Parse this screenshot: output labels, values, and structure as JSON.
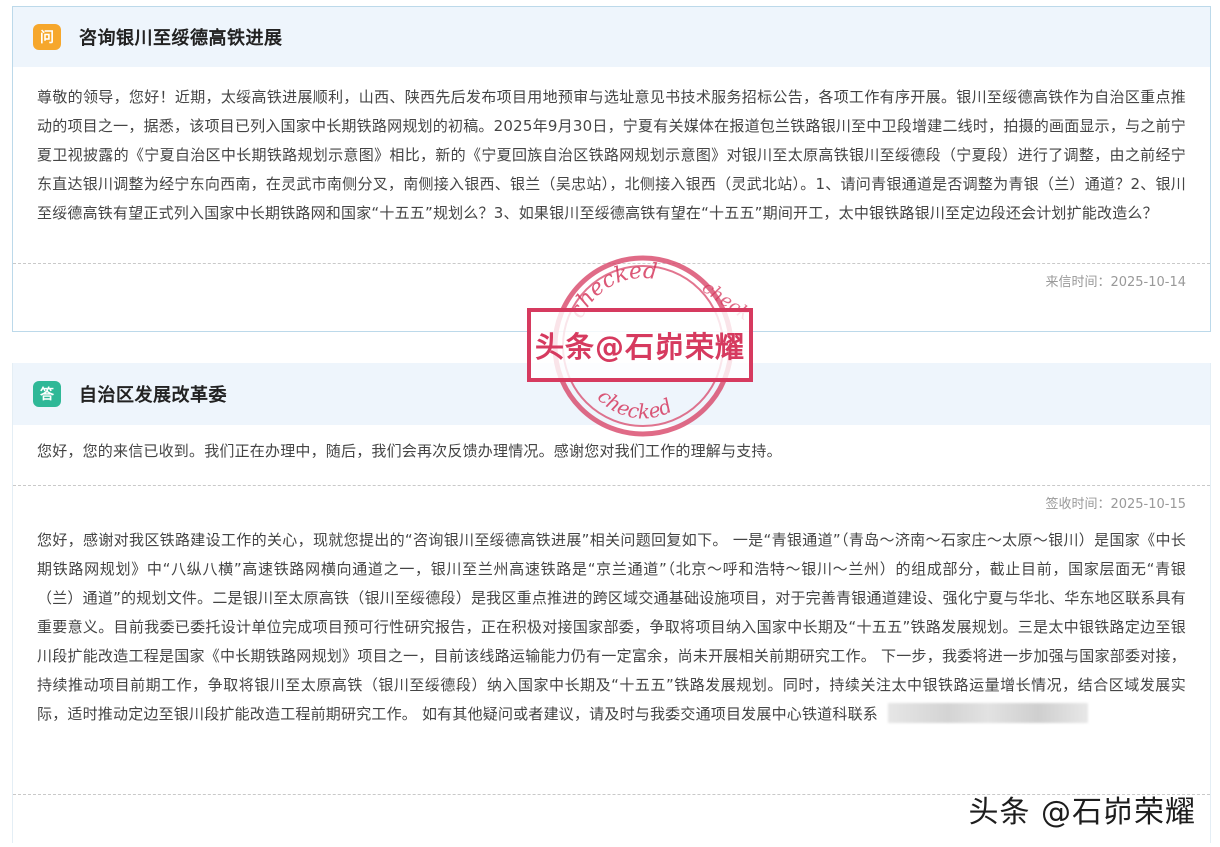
{
  "question": {
    "tag": "问",
    "title": "咨询银川至绥德高铁进展",
    "text": "尊敬的领导，您好！近期，太绥高铁进展顺利，山西、陕西先后发布项目用地预审与选址意见书技术服务招标公告，各项工作有序开展。银川至绥德高铁作为自治区重点推动的项目之一，据悉，该项目已列入国家中长期铁路网规划的初稿。2025年9月30日，宁夏有关媒体在报道包兰铁路银川至中卫段增建二线时，拍摄的画面显示，与之前宁夏卫视披露的《宁夏自治区中长期铁路规划示意图》相比，新的《宁夏回族自治区铁路网规划示意图》对银川至太原高铁银川至绥德段（宁夏段）进行了调整，由之前经宁东直达银川调整为经宁东向西南，在灵武市南侧分叉，南侧接入银西、银兰（吴忠站），北侧接入银西（灵武北站）。1、请问青银通道是否调整为青银（兰）通道？2、银川至绥德高铁有望正式列入国家中长期铁路网和国家“十五五”规划么？3、如果银川至绥德高铁有望在“十五五”期间开工，太中银铁路银川至定边段还会计划扩能改造么？",
    "time": "来信时间：2025-10-14"
  },
  "answer": {
    "tag": "答",
    "title": "自治区发展改革委",
    "short_text": "您好，您的来信已收到。我们正在办理中，随后，我们会再次反馈办理情况。感谢您对我们工作的理解与支持。",
    "time": "签收时间：2025-10-15",
    "long_text": "您好，感谢对我区铁路建设工作的关心，现就您提出的“咨询银川至绥德高铁进展”相关问题回复如下。 一是“青银通道”（青岛～济南～石家庄～太原～银川）是国家《中长期铁路网规划》中“八纵八横”高速铁路网横向通道之一，银川至兰州高速铁路是“京兰通道”（北京～呼和浩特～银川～兰州）的组成部分，截止目前，国家层面无“青银（兰）通道”的规划文件。二是银川至太原高铁（银川至绥德段）是我区重点推进的跨区域交通基础设施项目，对于完善青银通道建设、强化宁夏与华北、华东地区联系具有重要意义。目前我委已委托设计单位完成项目预可行性研究报告，正在积极对接国家部委，争取将项目纳入国家中长期及“十五五”铁路发展规划。三是太中银铁路定边至银川段扩能改造工程是国家《中长期铁路网规划》项目之一，目前该线路运输能力仍有一定富余，尚未开展相关前期研究工作。 下一步，我委将进一步加强与国家部委对接，持续推动项目前期工作，争取将银川至太原高铁（银川至绥德段）纳入国家中长期及“十五五”铁路发展规划。同时，持续关注太中银铁路运量增长情况，结合区域发展实际，适时推动定边至银川段扩能改造工程前期研究工作。 如有其他疑问或者建议，请及时与我委交通项目发展中心铁道科联系"
  },
  "stamp": {
    "text": "头条@石峁荣耀",
    "ring_top": "checked",
    "ring_side": "check",
    "ring_bottom": "checked",
    "color": "#d63a5f"
  },
  "watermark": "头条 @石峁荣耀"
}
